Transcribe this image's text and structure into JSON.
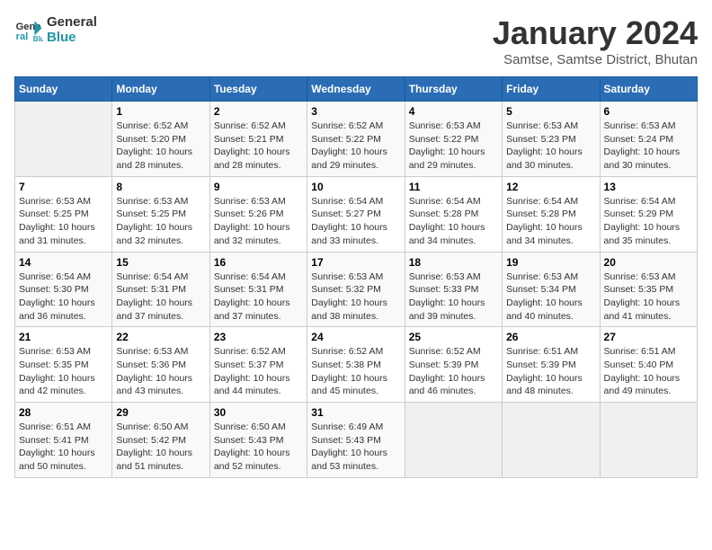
{
  "logo": {
    "line1": "General",
    "line2": "Blue"
  },
  "title": "January 2024",
  "subtitle": "Samtse, Samtse District, Bhutan",
  "days_header": [
    "Sunday",
    "Monday",
    "Tuesday",
    "Wednesday",
    "Thursday",
    "Friday",
    "Saturday"
  ],
  "weeks": [
    [
      {
        "day": "",
        "info": ""
      },
      {
        "day": "1",
        "info": "Sunrise: 6:52 AM\nSunset: 5:20 PM\nDaylight: 10 hours\nand 28 minutes."
      },
      {
        "day": "2",
        "info": "Sunrise: 6:52 AM\nSunset: 5:21 PM\nDaylight: 10 hours\nand 28 minutes."
      },
      {
        "day": "3",
        "info": "Sunrise: 6:52 AM\nSunset: 5:22 PM\nDaylight: 10 hours\nand 29 minutes."
      },
      {
        "day": "4",
        "info": "Sunrise: 6:53 AM\nSunset: 5:22 PM\nDaylight: 10 hours\nand 29 minutes."
      },
      {
        "day": "5",
        "info": "Sunrise: 6:53 AM\nSunset: 5:23 PM\nDaylight: 10 hours\nand 30 minutes."
      },
      {
        "day": "6",
        "info": "Sunrise: 6:53 AM\nSunset: 5:24 PM\nDaylight: 10 hours\nand 30 minutes."
      }
    ],
    [
      {
        "day": "7",
        "info": "Sunrise: 6:53 AM\nSunset: 5:25 PM\nDaylight: 10 hours\nand 31 minutes."
      },
      {
        "day": "8",
        "info": "Sunrise: 6:53 AM\nSunset: 5:25 PM\nDaylight: 10 hours\nand 32 minutes."
      },
      {
        "day": "9",
        "info": "Sunrise: 6:53 AM\nSunset: 5:26 PM\nDaylight: 10 hours\nand 32 minutes."
      },
      {
        "day": "10",
        "info": "Sunrise: 6:54 AM\nSunset: 5:27 PM\nDaylight: 10 hours\nand 33 minutes."
      },
      {
        "day": "11",
        "info": "Sunrise: 6:54 AM\nSunset: 5:28 PM\nDaylight: 10 hours\nand 34 minutes."
      },
      {
        "day": "12",
        "info": "Sunrise: 6:54 AM\nSunset: 5:28 PM\nDaylight: 10 hours\nand 34 minutes."
      },
      {
        "day": "13",
        "info": "Sunrise: 6:54 AM\nSunset: 5:29 PM\nDaylight: 10 hours\nand 35 minutes."
      }
    ],
    [
      {
        "day": "14",
        "info": "Sunrise: 6:54 AM\nSunset: 5:30 PM\nDaylight: 10 hours\nand 36 minutes."
      },
      {
        "day": "15",
        "info": "Sunrise: 6:54 AM\nSunset: 5:31 PM\nDaylight: 10 hours\nand 37 minutes."
      },
      {
        "day": "16",
        "info": "Sunrise: 6:54 AM\nSunset: 5:31 PM\nDaylight: 10 hours\nand 37 minutes."
      },
      {
        "day": "17",
        "info": "Sunrise: 6:53 AM\nSunset: 5:32 PM\nDaylight: 10 hours\nand 38 minutes."
      },
      {
        "day": "18",
        "info": "Sunrise: 6:53 AM\nSunset: 5:33 PM\nDaylight: 10 hours\nand 39 minutes."
      },
      {
        "day": "19",
        "info": "Sunrise: 6:53 AM\nSunset: 5:34 PM\nDaylight: 10 hours\nand 40 minutes."
      },
      {
        "day": "20",
        "info": "Sunrise: 6:53 AM\nSunset: 5:35 PM\nDaylight: 10 hours\nand 41 minutes."
      }
    ],
    [
      {
        "day": "21",
        "info": "Sunrise: 6:53 AM\nSunset: 5:35 PM\nDaylight: 10 hours\nand 42 minutes."
      },
      {
        "day": "22",
        "info": "Sunrise: 6:53 AM\nSunset: 5:36 PM\nDaylight: 10 hours\nand 43 minutes."
      },
      {
        "day": "23",
        "info": "Sunrise: 6:52 AM\nSunset: 5:37 PM\nDaylight: 10 hours\nand 44 minutes."
      },
      {
        "day": "24",
        "info": "Sunrise: 6:52 AM\nSunset: 5:38 PM\nDaylight: 10 hours\nand 45 minutes."
      },
      {
        "day": "25",
        "info": "Sunrise: 6:52 AM\nSunset: 5:39 PM\nDaylight: 10 hours\nand 46 minutes."
      },
      {
        "day": "26",
        "info": "Sunrise: 6:51 AM\nSunset: 5:39 PM\nDaylight: 10 hours\nand 48 minutes."
      },
      {
        "day": "27",
        "info": "Sunrise: 6:51 AM\nSunset: 5:40 PM\nDaylight: 10 hours\nand 49 minutes."
      }
    ],
    [
      {
        "day": "28",
        "info": "Sunrise: 6:51 AM\nSunset: 5:41 PM\nDaylight: 10 hours\nand 50 minutes."
      },
      {
        "day": "29",
        "info": "Sunrise: 6:50 AM\nSunset: 5:42 PM\nDaylight: 10 hours\nand 51 minutes."
      },
      {
        "day": "30",
        "info": "Sunrise: 6:50 AM\nSunset: 5:43 PM\nDaylight: 10 hours\nand 52 minutes."
      },
      {
        "day": "31",
        "info": "Sunrise: 6:49 AM\nSunset: 5:43 PM\nDaylight: 10 hours\nand 53 minutes."
      },
      {
        "day": "",
        "info": ""
      },
      {
        "day": "",
        "info": ""
      },
      {
        "day": "",
        "info": ""
      }
    ]
  ]
}
